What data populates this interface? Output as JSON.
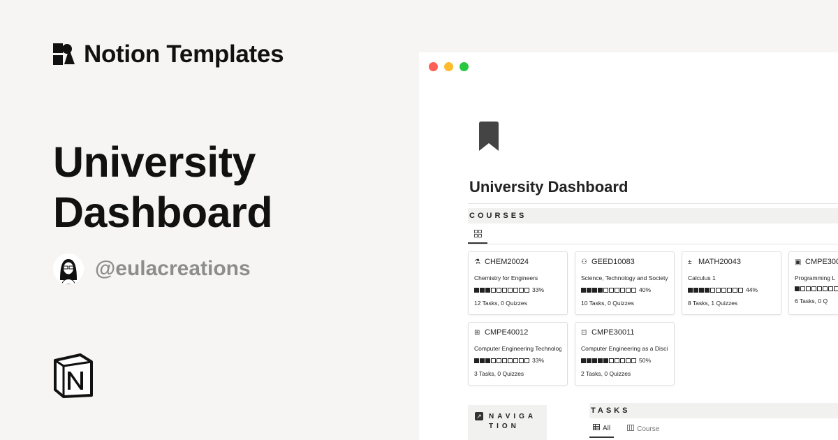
{
  "brand": {
    "title": "Notion Templates"
  },
  "hero": {
    "title_line1": "University",
    "title_line2": "Dashboard"
  },
  "author": {
    "handle": "@eulacreations"
  },
  "window": {
    "page_title": "University Dashboard",
    "courses_heading": "COURSES",
    "courses": [
      {
        "code": "CHEM20024",
        "icon": "flask-icon",
        "name": "Chemistry for Engineers",
        "progress": 0.33,
        "progress_label": "33%",
        "counts": "12 Tasks, 0 Quizzes"
      },
      {
        "code": "GEED10083",
        "icon": "people-icon",
        "name": "Science, Technology and Society",
        "progress": 0.4,
        "progress_label": "40%",
        "counts": "10 Tasks, 0 Quizzes"
      },
      {
        "code": "MATH20043",
        "icon": "calculator-icon",
        "name": "Calculus 1",
        "progress": 0.44,
        "progress_label": "44%",
        "counts": "8 Tasks, 1 Quizzes"
      },
      {
        "code": "CMPE300",
        "icon": "terminal-icon",
        "name": "Programming L",
        "progress": 0.1,
        "progress_label": "",
        "counts": "6 Tasks, 0 Q"
      },
      {
        "code": "CMPE40012",
        "icon": "chip-icon",
        "name": "Computer Engineering Technolog",
        "progress": 0.33,
        "progress_label": "33%",
        "counts": "3 Tasks, 0 Quizzes"
      },
      {
        "code": "CMPE30011",
        "icon": "robot-icon",
        "name": "Computer Engineering as a Disci",
        "progress": 0.5,
        "progress_label": "50%",
        "counts": "2 Tasks, 0 Quizzes"
      }
    ],
    "navigation_heading": "NAVIGATION",
    "tasks_heading": "TASKS",
    "task_tabs": [
      {
        "label": "All",
        "icon": "table-icon"
      },
      {
        "label": "Course",
        "icon": "board-icon"
      }
    ]
  }
}
